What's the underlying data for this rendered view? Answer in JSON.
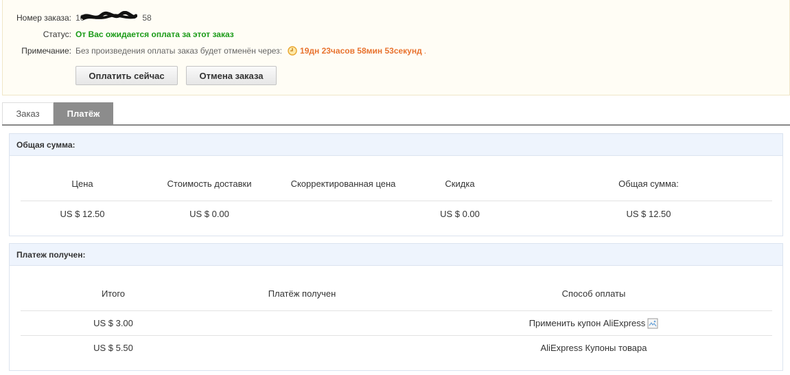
{
  "order": {
    "number_label": "Номер заказа:",
    "number_prefix": "10",
    "number_suffix": "58",
    "status_label": "Статус:",
    "status_text": "От Вас ожидается оплата за этот заказ",
    "note_label": "Примечание:",
    "note_text": "Без произведения оплаты заказ будет отменён через:",
    "countdown": "19дн 23часов 58мин 53секунд",
    "countdown_end": ".",
    "pay_button": "Оплатить сейчас",
    "cancel_button": "Отмена заказа"
  },
  "tabs": {
    "order": "Заказ",
    "payment": "Платёж"
  },
  "total_panel": {
    "title": "Общая сумма:",
    "headers": [
      "Цена",
      "Стоимость доставки",
      "Скорректированная цена",
      "Скидка",
      "Общая сумма:"
    ],
    "values": [
      "US $ 12.50",
      "US $ 0.00",
      "",
      "US $ 0.00",
      "US $ 12.50"
    ]
  },
  "received_panel": {
    "title": "Платеж получен:",
    "headers": [
      "Итого",
      "Платёж получен",
      "Способ оплаты"
    ],
    "rows": [
      {
        "total": "US $ 3.00",
        "received": "",
        "method": "Применить купон AliExpress"
      },
      {
        "total": "US $ 5.50",
        "received": "",
        "method": "AliExpress Купоны товара"
      }
    ]
  },
  "colors": {
    "status_green": "#1a9b18",
    "countdown_orange": "#e8732f",
    "panel_header_bg": "#eef4fd",
    "active_tab_bg": "#8c8c8c"
  },
  "icons": [
    "clock-icon",
    "broken-image-icon"
  ]
}
